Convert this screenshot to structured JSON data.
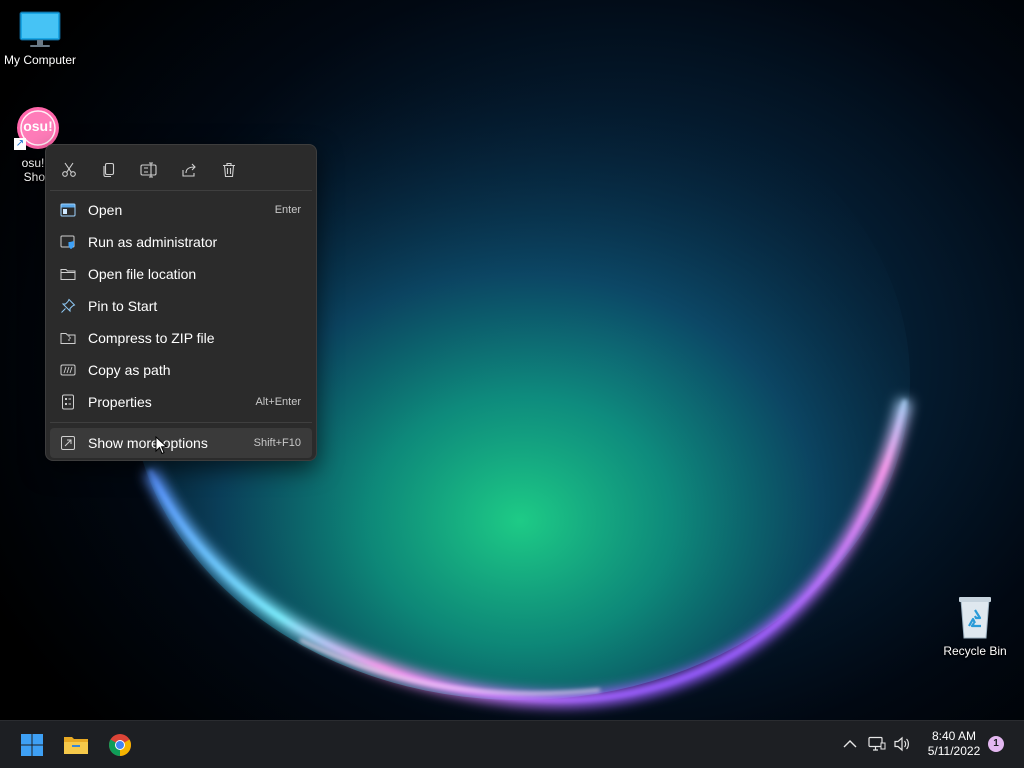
{
  "desktop": {
    "icons": [
      {
        "label": "My Computer"
      },
      {
        "label_line1": "osu!.e",
        "label_line2": "Short",
        "logo_text": "osu!"
      },
      {
        "label": "Recycle Bin"
      }
    ]
  },
  "context_menu": {
    "quick_actions": [
      "cut-icon",
      "copy-icon",
      "rename-icon",
      "share-icon",
      "delete-icon"
    ],
    "items": [
      {
        "label": "Open",
        "shortcut": "Enter",
        "icon": "open-icon"
      },
      {
        "label": "Run as administrator",
        "shortcut": "",
        "icon": "shield-icon"
      },
      {
        "label": "Open file location",
        "shortcut": "",
        "icon": "folder-icon"
      },
      {
        "label": "Pin to Start",
        "shortcut": "",
        "icon": "pin-icon"
      },
      {
        "label": "Compress to ZIP file",
        "shortcut": "",
        "icon": "zip-icon"
      },
      {
        "label": "Copy as path",
        "shortcut": "",
        "icon": "copy-path-icon"
      },
      {
        "label": "Properties",
        "shortcut": "Alt+Enter",
        "icon": "properties-icon"
      }
    ],
    "more": {
      "label": "Show more options",
      "shortcut": "Shift+F10",
      "icon": "more-options-icon"
    }
  },
  "taskbar": {
    "apps": [
      "start-icon",
      "file-explorer-icon",
      "chrome-icon"
    ],
    "time": "8:40 AM",
    "date": "5/11/2022",
    "notification_count": "1"
  },
  "colors": {
    "menu_bg": "#2b2b2b",
    "menu_hover": "#3a3a3a",
    "taskbar_bg": "#1d1f23",
    "accent": "#3ea0f5"
  }
}
